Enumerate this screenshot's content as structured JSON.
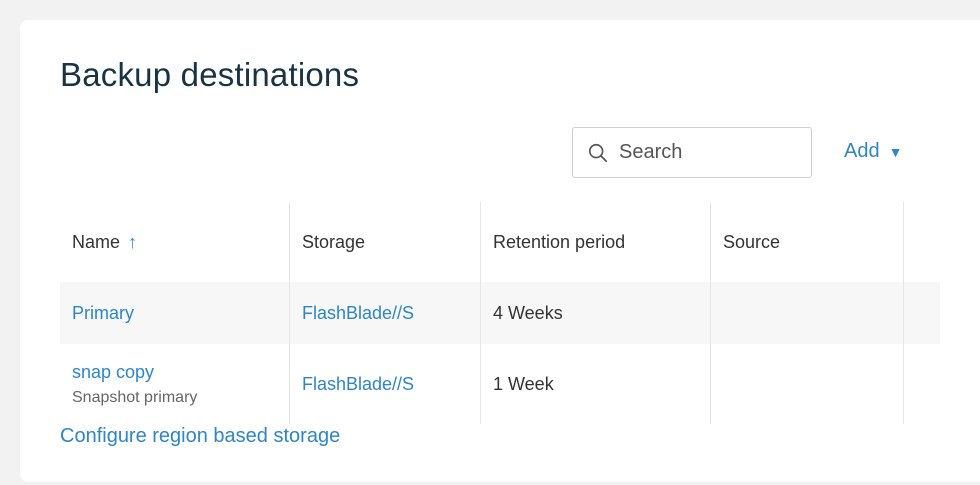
{
  "panel": {
    "title": "Backup destinations"
  },
  "toolbar": {
    "search_placeholder": "Search",
    "add_label": "Add",
    "add_caret": "▼",
    "search_icon": "search-icon"
  },
  "table": {
    "columns": [
      {
        "label": "Name",
        "sort": "↑"
      },
      {
        "label": "Storage"
      },
      {
        "label": "Retention period"
      },
      {
        "label": "Source"
      }
    ],
    "rows": [
      {
        "name": "Primary",
        "subtitle": "",
        "storage": "FlashBlade//S",
        "retention": "4 Weeks",
        "source": ""
      },
      {
        "name": "snap copy",
        "subtitle": "Snapshot primary",
        "storage": "FlashBlade//S",
        "retention": "1 Week",
        "source": ""
      }
    ]
  },
  "footer": {
    "configure_link": "Configure region based storage"
  },
  "colors": {
    "accent": "#2e86c7",
    "title": "#183344",
    "row_highlight": "#f7f7f7"
  }
}
